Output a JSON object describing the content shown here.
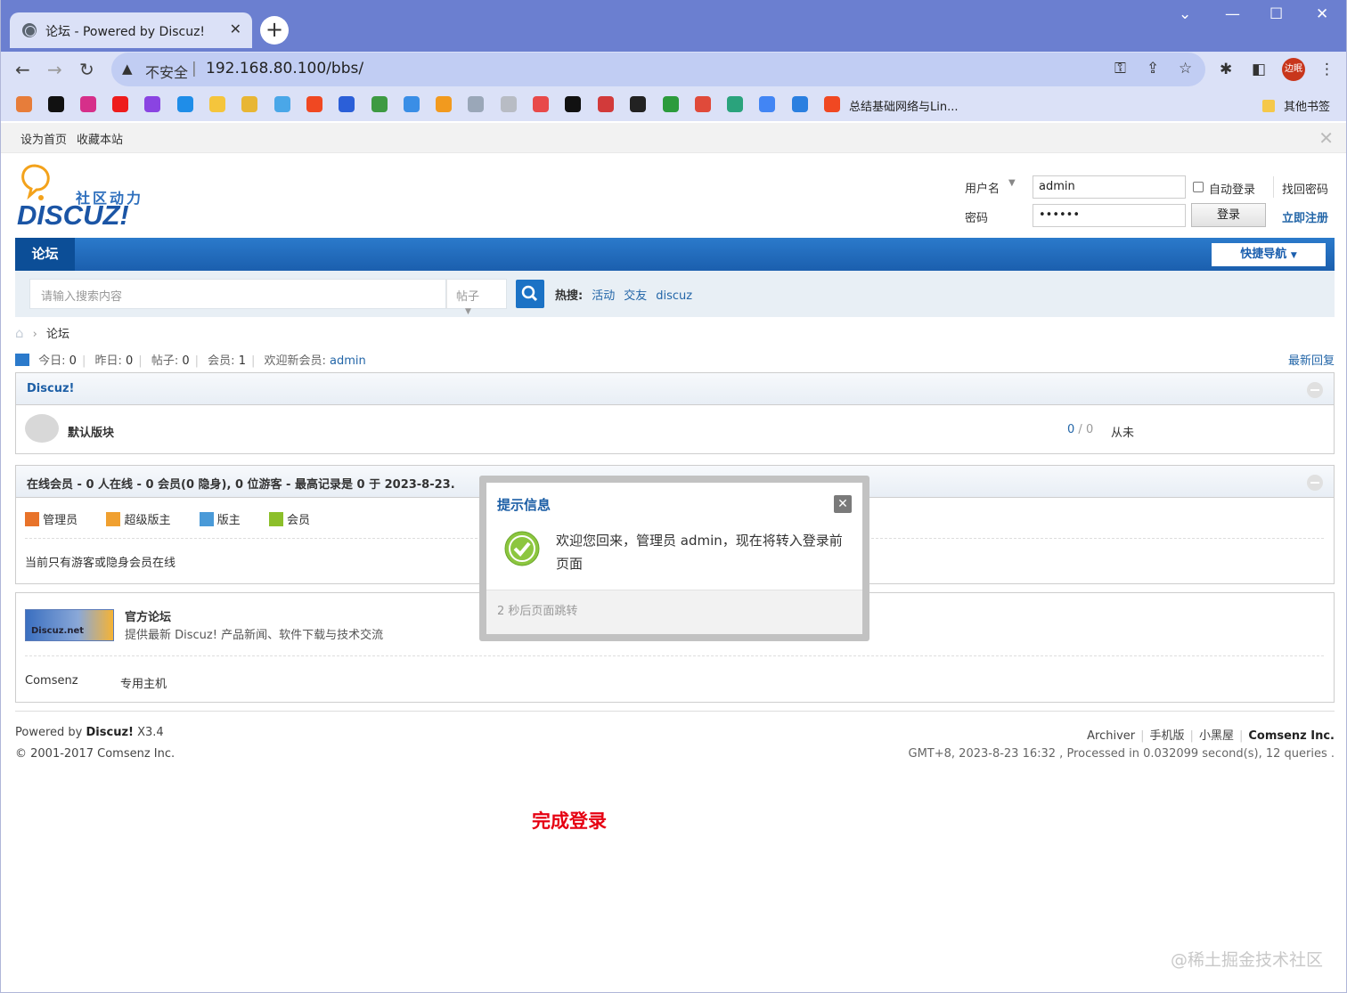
{
  "browser": {
    "tab_title": "论坛 - Powered by Discuz!",
    "insecure_label": "不安全",
    "url": "192.168.80.100/bbs/",
    "profile_label": "边眠",
    "bookmark_folder_label": "总结基础网络与Lin...",
    "other_bookmarks": "其他书签"
  },
  "topbar": {
    "set_home": "设为首页",
    "favorite": "收藏本站"
  },
  "logo": {
    "tagline": "社区动力",
    "brand": "DISCUZ!"
  },
  "login": {
    "username_label": "用户名",
    "username_value": "admin",
    "password_label": "密码",
    "password_value": "••••••",
    "auto_login": "自动登录",
    "login_button": "登录",
    "find_password": "找回密码",
    "register": "立即注册"
  },
  "nav": {
    "active_item": "论坛",
    "quick_nav": "快捷导航"
  },
  "search": {
    "placeholder": "请输入搜索内容",
    "type": "帖子",
    "hot_label": "热搜:",
    "hot_items": [
      "活动",
      "交友",
      "discuz"
    ]
  },
  "breadcrumb": {
    "current": "论坛"
  },
  "stats": {
    "today_label": "今日:",
    "today": "0",
    "yesterday_label": "昨日:",
    "yesterday": "0",
    "posts_label": "帖子:",
    "posts": "0",
    "members_label": "会员:",
    "members": "1",
    "newest_label": "欢迎新会员:",
    "newest": "admin",
    "latest_reply": "最新回复"
  },
  "category": {
    "title": "Discuz!",
    "forums": [
      {
        "name": "默认版块",
        "threads": "0",
        "posts": "0",
        "last": "从未"
      }
    ]
  },
  "online": {
    "title": "在线会员 - 0 人在线 - 0 会员(0 隐身), 0 位游客 - 最高记录是 0 于 2023-8-23.",
    "legend": [
      "管理员",
      "超级版主",
      "版主",
      "会员"
    ],
    "legend_colors": [
      "#e8732a",
      "#f0a030",
      "#4a9ad8",
      "#8cbf2a"
    ],
    "empty_text": "当前只有游客或隐身会员在线"
  },
  "links": {
    "banner_text": "Discuz.net",
    "title": "官方论坛",
    "desc": "提供最新 Discuz! 产品新闻、软件下载与技术交流",
    "text_links": [
      "Comsenz",
      "专用主机"
    ]
  },
  "footer": {
    "powered_prefix": "Powered by",
    "powered_brand": "Discuz!",
    "version": "X3.4",
    "copyright": "© 2001-2017 Comsenz Inc.",
    "links": [
      "Archiver",
      "手机版",
      "小黑屋",
      "Comsenz Inc."
    ],
    "status": "GMT+8, 2023-8-23 16:32 , Processed in 0.032099 second(s), 12 queries ."
  },
  "dialog": {
    "title": "提示信息",
    "message": "欢迎您回来，管理员 admin，现在将转入登录前页面",
    "footer": "2 秒后页面跳转"
  },
  "annotation": "完成登录",
  "watermark": "@稀土掘金技术社区",
  "colors": {
    "accent": "#1b5fae",
    "link": "#2366a8",
    "annotation": "#e60012"
  }
}
